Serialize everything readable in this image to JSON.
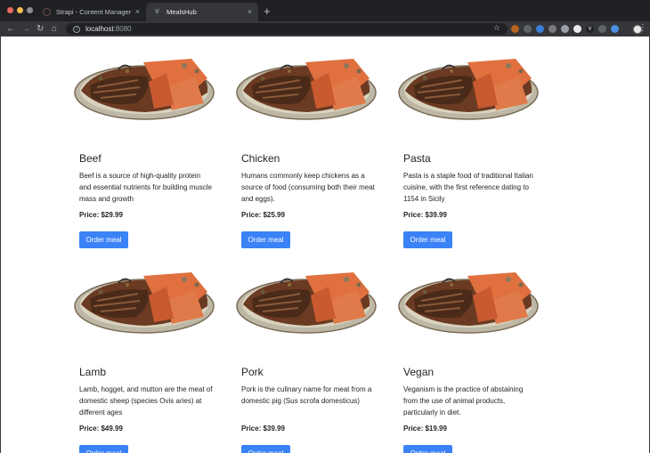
{
  "browser": {
    "tabs": [
      {
        "title": "Strapi - Content Manager",
        "active": false
      },
      {
        "title": "MealsHub",
        "active": true
      }
    ],
    "address": {
      "host": "localhost",
      "port": ":8080"
    }
  },
  "meals": [
    {
      "name": "Beef",
      "description": "Beef is a source of high-quality protein and essential nutrients for building muscle mass and growth",
      "price": "Price: $29.99",
      "button": "Order meal"
    },
    {
      "name": "Chicken",
      "description": "Humans commonly keep chickens as a source of food (consuming both their meat and eggs).",
      "price": "Price: $25.99",
      "button": "Order meal"
    },
    {
      "name": "Pasta",
      "description": "Pasta is a staple food of traditional Italian cuisine, with the first reference dating to 1154 in Sicily",
      "price": "Price: $39.99",
      "button": "Order meal"
    },
    {
      "name": "Lamb",
      "description": "Lamb, hogget, and mutton are the meat of domestic sheep (species Ovis aries) at different ages",
      "price": "Price: $49.99",
      "button": "Order meal"
    },
    {
      "name": "Pork",
      "description": "Pork is the culinary name for meat from a domestic pig (Sus scrofa domesticus)",
      "price": "Price: $39.99",
      "button": "Order meal"
    },
    {
      "name": "Vegan",
      "description": "Veganism is the practice of abstaining from the use of animal products, particularly in diet.",
      "price": "Price: $19.99",
      "button": "Order meal"
    }
  ]
}
